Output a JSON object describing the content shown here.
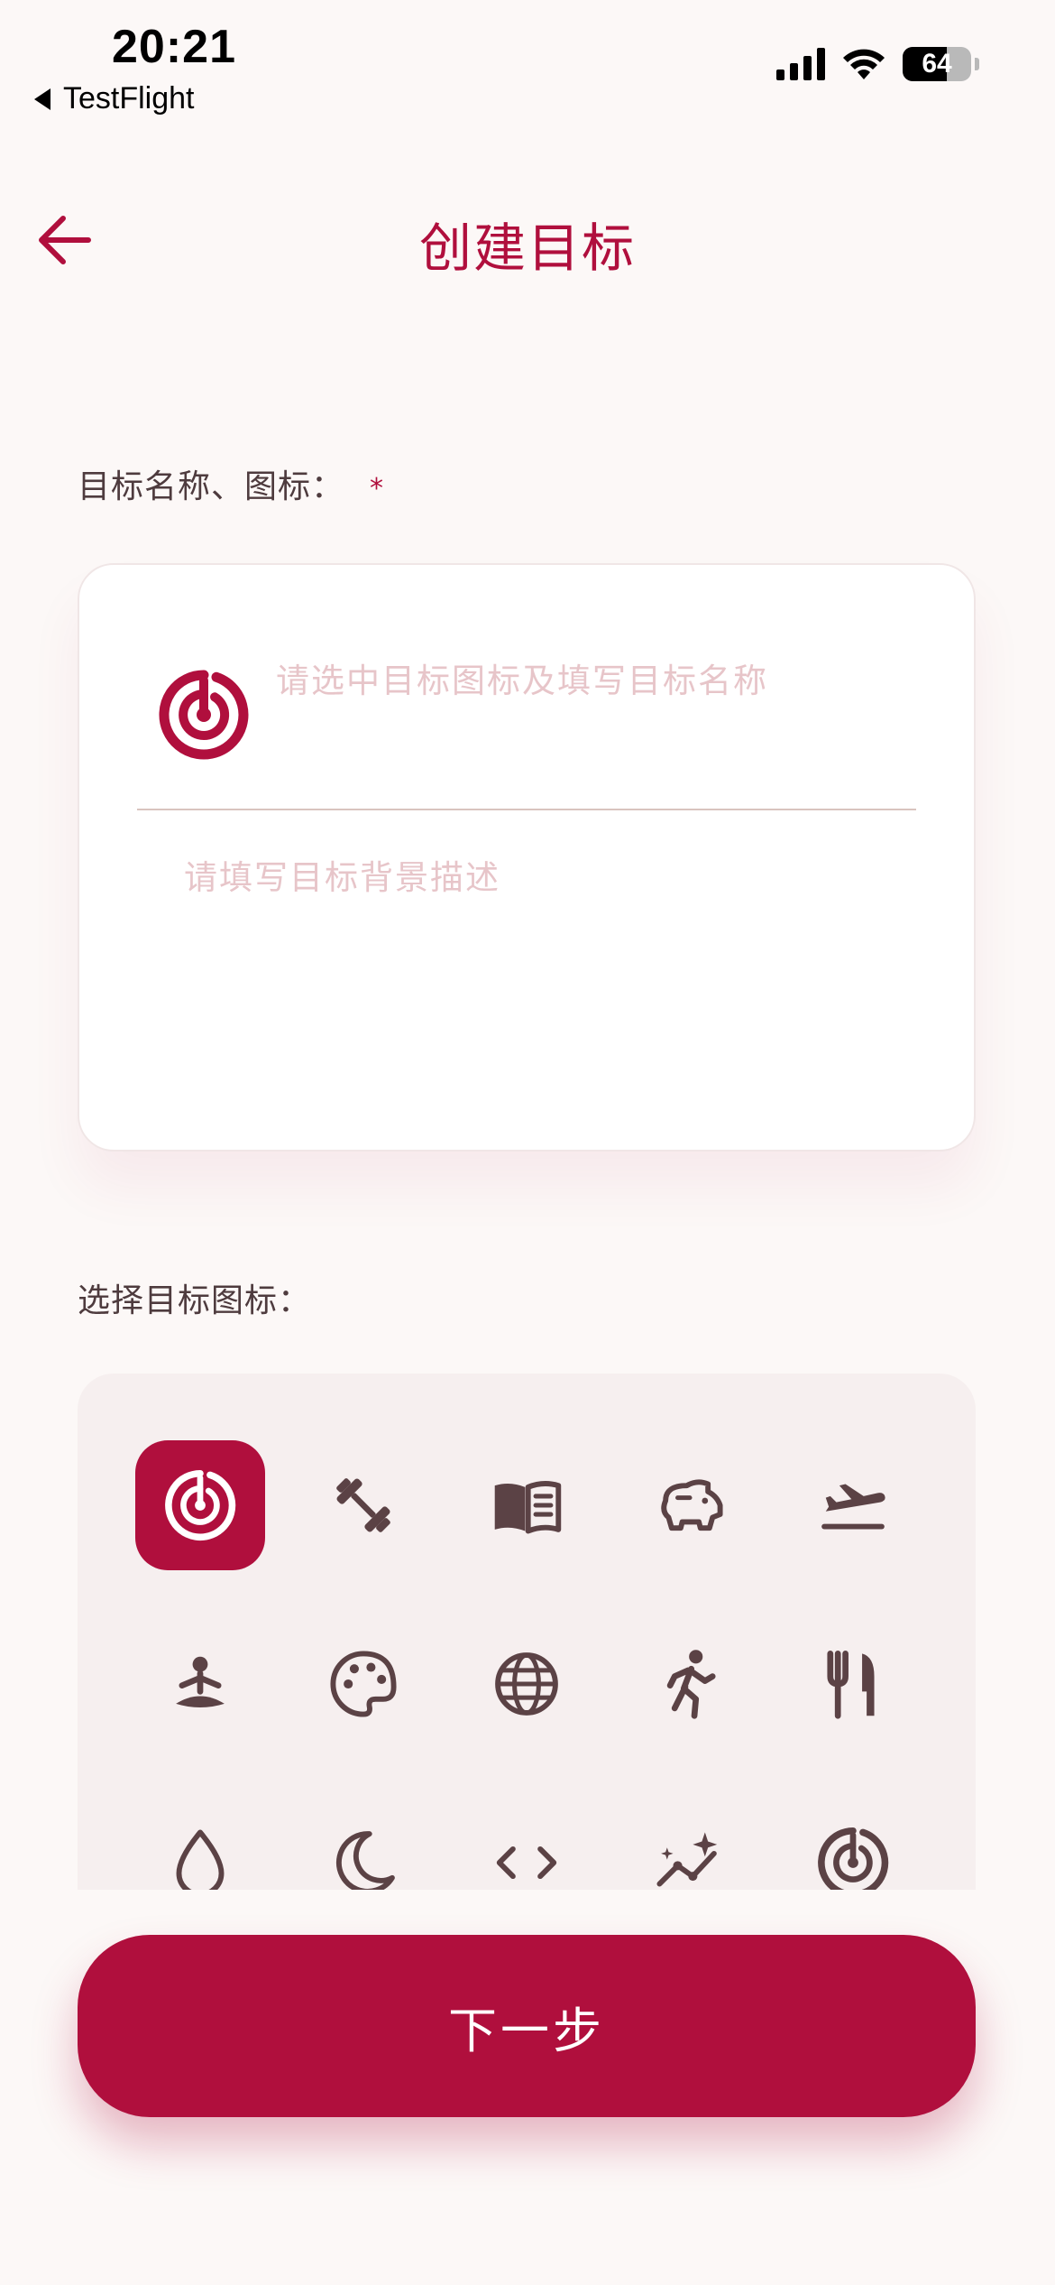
{
  "status_bar": {
    "time": "20:21",
    "back_app": "TestFlight",
    "battery_level": 64,
    "battery_text": "64"
  },
  "header": {
    "title": "创建目标",
    "back_icon": "arrow-left-icon"
  },
  "form": {
    "name_label": "目标名称、图标：",
    "required_mark": "*",
    "name_placeholder": "请选中目标图标及填写目标名称",
    "desc_placeholder": "请填写目标背景描述",
    "selected_icon": "target-icon"
  },
  "icon_picker": {
    "label": "选择目标图标：",
    "selected_index": 0,
    "icons": [
      "target-icon",
      "dumbbell-icon",
      "book-icon",
      "piggy-bank-icon",
      "airplane-takeoff-icon",
      "meditation-icon",
      "palette-icon",
      "globe-icon",
      "running-icon",
      "fork-knife-icon",
      "water-drop-icon",
      "moon-icon",
      "code-icon",
      "trend-sparkle-icon",
      "target-icon"
    ]
  },
  "footer": {
    "next_label": "下一步"
  },
  "colors": {
    "accent": "#b00f3d",
    "icon": "#5b4245",
    "background": "#fcf8f7",
    "placeholder": "#e7c5c9"
  }
}
